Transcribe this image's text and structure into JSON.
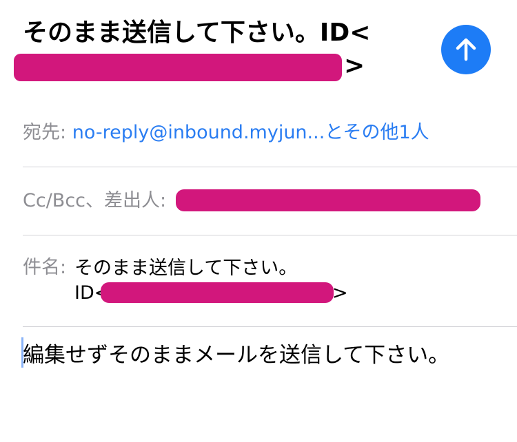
{
  "compose": {
    "title_line1": "そのまま送信して下さい。ID<",
    "title_line2_suffix": ">",
    "to_label": "宛先:",
    "to_value": "no-reply@inbound.myjun...とその他1人",
    "cc_label": "Cc/Bcc、差出人:",
    "subject_label": "件名:",
    "subject_line1": "そのまま送信して下さい。",
    "subject_line2_prefix": "ID<",
    "subject_line2_suffix": ">",
    "body": "編集せずそのままメールを送信して下さい。"
  },
  "colors": {
    "accent": "#1d7cf6",
    "link": "#2a7df2",
    "redaction": "#d2177c",
    "label_gray": "#8e8e93"
  },
  "icons": {
    "send": "arrow-up-icon"
  }
}
